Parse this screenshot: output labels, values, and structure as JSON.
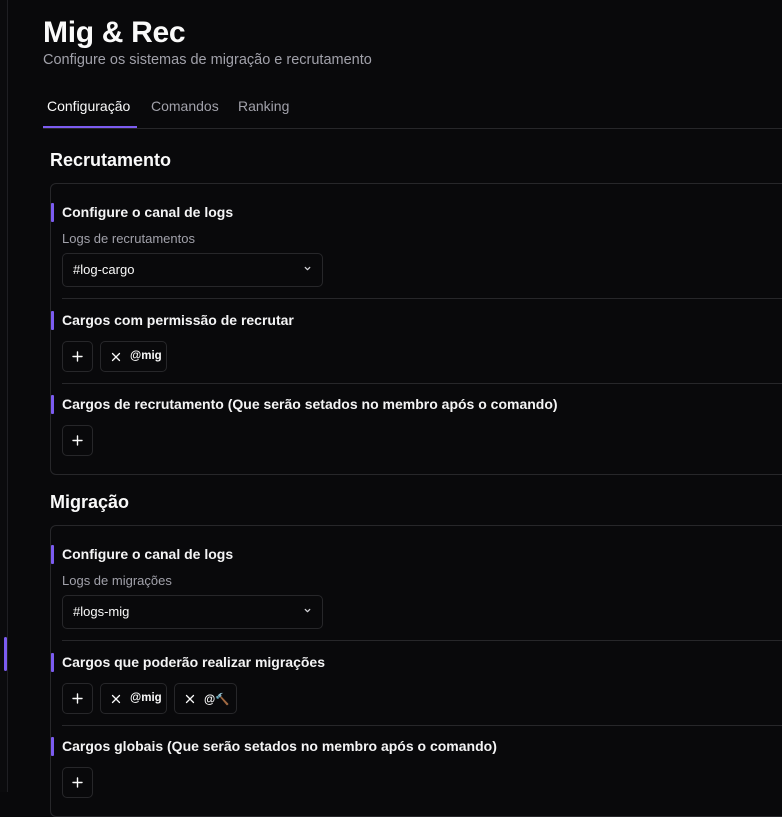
{
  "header": {
    "title": "Mig & Rec",
    "subtitle": "Configure os sistemas de migração e recrutamento"
  },
  "tabs": [
    {
      "label": "Configuração",
      "active": true
    },
    {
      "label": "Comandos",
      "active": false
    },
    {
      "label": "Ranking",
      "active": false
    }
  ],
  "recrutamento": {
    "title": "Recrutamento",
    "log_channel": {
      "label": "Configure o canal de logs",
      "sublabel": "Logs de recrutamentos",
      "selected": "#log-cargo"
    },
    "permission_roles": {
      "label": "Cargos com permissão de recrutar",
      "roles": [
        "@mig"
      ]
    },
    "recruit_roles": {
      "label": "Cargos de recrutamento (Que serão setados no membro após o comando)",
      "roles": []
    }
  },
  "migracao": {
    "title": "Migração",
    "log_channel": {
      "label": "Configure o canal de logs",
      "sublabel": "Logs de migrações",
      "selected": "#logs-mig"
    },
    "migration_roles": {
      "label": "Cargos que poderão realizar migrações",
      "roles": [
        "@mig",
        "@🔨"
      ]
    },
    "global_roles": {
      "label": "Cargos globais (Que serão setados no membro após o comando)",
      "roles": []
    }
  },
  "colors": {
    "accent": "#7c5cf0",
    "background": "#09090b",
    "border": "#27272a",
    "muted_text": "#a1a1aa"
  },
  "icons": {
    "add": "plus-icon",
    "remove": "close-icon",
    "dropdown": "chevron-down-icon"
  }
}
